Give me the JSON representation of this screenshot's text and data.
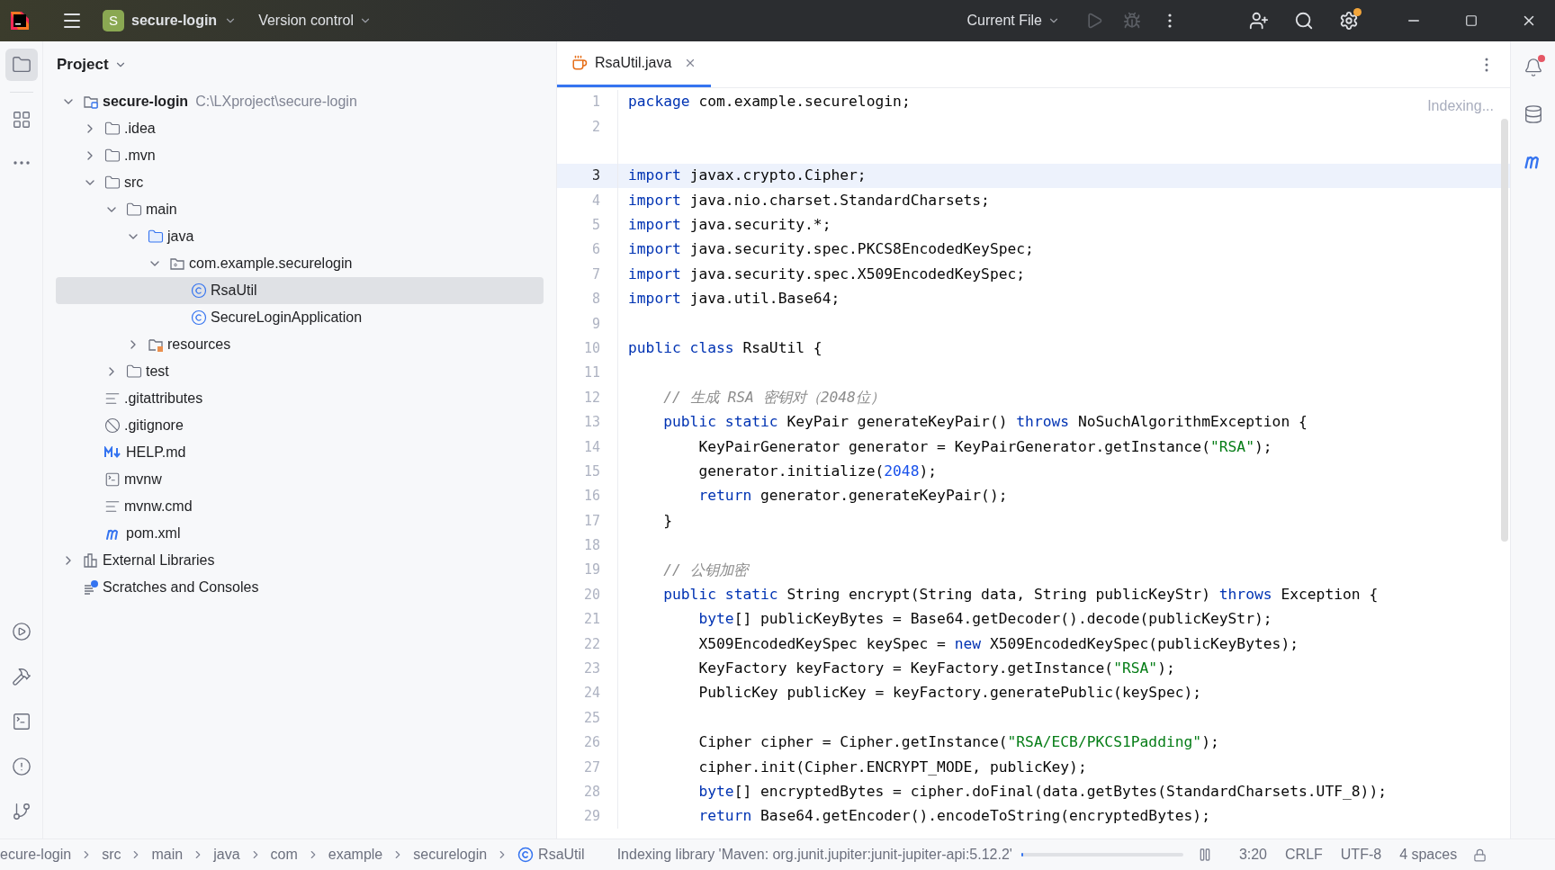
{
  "title_bar": {
    "project_badge": "S",
    "project": "secure-login",
    "vcs": "Version control",
    "run_config": "Current File",
    "run_disabled": true,
    "debug_disabled": true,
    "settings_notice": true
  },
  "left_toolbar": {
    "top": [
      {
        "kind": "project",
        "selected": true
      },
      {
        "kind": "structure",
        "selected": false
      },
      {
        "kind": "more",
        "selected": false
      }
    ],
    "bottom": [
      {
        "kind": "run",
        "selected": false
      },
      {
        "kind": "build",
        "selected": false
      },
      {
        "kind": "terminal",
        "selected": false
      },
      {
        "kind": "problems",
        "selected": false
      },
      {
        "kind": "git",
        "selected": false
      }
    ]
  },
  "project_panel": {
    "title": "Project",
    "tree": [
      {
        "kind": "module",
        "label": "secure-login",
        "path": "C:\\LXproject\\secure-login",
        "expanded": true,
        "selected": false,
        "children": [
          {
            "kind": "folder",
            "label": ".idea",
            "expanded": false,
            "selected": false
          },
          {
            "kind": "folder",
            "label": ".mvn",
            "expanded": false,
            "selected": false
          },
          {
            "kind": "folder",
            "label": "src",
            "expanded": true,
            "selected": false,
            "children": [
              {
                "kind": "folder",
                "label": "main",
                "expanded": true,
                "selected": false,
                "children": [
                  {
                    "kind": "source",
                    "label": "java",
                    "expanded": true,
                    "selected": false,
                    "children": [
                      {
                        "kind": "package",
                        "label": "com.example.securelogin",
                        "expanded": true,
                        "selected": false,
                        "children": [
                          {
                            "kind": "class",
                            "label": "RsaUtil",
                            "selected": true
                          },
                          {
                            "kind": "class",
                            "label": "SecureLoginApplication",
                            "selected": false
                          }
                        ]
                      }
                    ]
                  },
                  {
                    "kind": "resources",
                    "label": "resources",
                    "expanded": false,
                    "selected": false
                  }
                ]
              },
              {
                "kind": "folder",
                "label": "test",
                "expanded": false,
                "selected": false
              }
            ]
          },
          {
            "kind": "text",
            "label": ".gitattributes",
            "selected": false
          },
          {
            "kind": "ignore",
            "label": ".gitignore",
            "selected": false
          },
          {
            "kind": "markdown",
            "label": "HELP.md",
            "selected": false
          },
          {
            "kind": "script",
            "label": "mvnw",
            "selected": false
          },
          {
            "kind": "text",
            "label": "mvnw.cmd",
            "selected": false
          },
          {
            "kind": "maven",
            "label": "pom.xml",
            "selected": false
          }
        ]
      },
      {
        "kind": "library",
        "label": "External Libraries",
        "expanded": false,
        "selected": false
      },
      {
        "kind": "scratches",
        "label": "Scratches and Consoles",
        "selected": false
      }
    ]
  },
  "editor": {
    "tabs": [
      {
        "label": "RsaUtil.java",
        "selected": true
      }
    ],
    "status": "Indexing...",
    "lines": [
      {
        "number": "1",
        "current": false,
        "tokens": [
          {
            "kind": "keyword",
            "text": "package"
          },
          {
            "kind": "plain",
            "text": " com.example.securelogin;"
          }
        ]
      },
      {
        "number": "2",
        "current": false,
        "gap_after": true
      },
      {
        "number": "3",
        "current": true,
        "tokens": [
          {
            "kind": "keyword",
            "text": "import"
          },
          {
            "kind": "plain",
            "text": " javax.crypto.Cipher;"
          }
        ]
      },
      {
        "number": "4",
        "current": false,
        "tokens": [
          {
            "kind": "keyword",
            "text": "import"
          },
          {
            "kind": "plain",
            "text": " java.nio.charset.StandardCharsets;"
          }
        ]
      },
      {
        "number": "5",
        "current": false,
        "tokens": [
          {
            "kind": "keyword",
            "text": "import"
          },
          {
            "kind": "plain",
            "text": " java.security.*;"
          }
        ]
      },
      {
        "number": "6",
        "current": false,
        "tokens": [
          {
            "kind": "keyword",
            "text": "import"
          },
          {
            "kind": "plain",
            "text": " java.security.spec.PKCS8EncodedKeySpec;"
          }
        ]
      },
      {
        "number": "7",
        "current": false,
        "tokens": [
          {
            "kind": "keyword",
            "text": "import"
          },
          {
            "kind": "plain",
            "text": " java.security.spec.X509EncodedKeySpec;"
          }
        ]
      },
      {
        "number": "8",
        "current": false,
        "tokens": [
          {
            "kind": "keyword",
            "text": "import"
          },
          {
            "kind": "plain",
            "text": " java.util.Base64;"
          }
        ]
      },
      {
        "number": "9",
        "current": false
      },
      {
        "number": "10",
        "current": false,
        "tokens": [
          {
            "kind": "keyword",
            "text": "public class"
          },
          {
            "kind": "plain",
            "text": " RsaUtil {"
          }
        ]
      },
      {
        "number": "11",
        "current": false
      },
      {
        "number": "12",
        "current": false,
        "tokens": [
          {
            "kind": "comment",
            "text": "    // 生成 RSA 密钥对（2048位）"
          }
        ]
      },
      {
        "number": "13",
        "current": false,
        "tokens": [
          {
            "kind": "keyword",
            "text": "    public static"
          },
          {
            "kind": "plain",
            "text": " KeyPair generateKeyPair() "
          },
          {
            "kind": "keyword",
            "text": "throws"
          },
          {
            "kind": "plain",
            "text": " NoSuchAlgorithmException {"
          }
        ]
      },
      {
        "number": "14",
        "current": false,
        "tokens": [
          {
            "kind": "plain",
            "text": "        KeyPairGenerator generator = KeyPairGenerator.getInstance("
          },
          {
            "kind": "string",
            "text": "\"RSA\""
          },
          {
            "kind": "plain",
            "text": ");"
          }
        ]
      },
      {
        "number": "15",
        "current": false,
        "tokens": [
          {
            "kind": "plain",
            "text": "        generator.initialize("
          },
          {
            "kind": "number",
            "text": "2048"
          },
          {
            "kind": "plain",
            "text": ");"
          }
        ]
      },
      {
        "number": "16",
        "current": false,
        "tokens": [
          {
            "kind": "keyword",
            "text": "        return"
          },
          {
            "kind": "plain",
            "text": " generator.generateKeyPair();"
          }
        ]
      },
      {
        "number": "17",
        "current": false,
        "tokens": [
          {
            "kind": "plain",
            "text": "    }"
          }
        ]
      },
      {
        "number": "18",
        "current": false
      },
      {
        "number": "19",
        "current": false,
        "tokens": [
          {
            "kind": "comment",
            "text": "    // 公钥加密"
          }
        ]
      },
      {
        "number": "20",
        "current": false,
        "tokens": [
          {
            "kind": "keyword",
            "text": "    public static"
          },
          {
            "kind": "plain",
            "text": " String encrypt(String data, String publicKeyStr) "
          },
          {
            "kind": "keyword",
            "text": "throws"
          },
          {
            "kind": "plain",
            "text": " Exception {"
          }
        ]
      },
      {
        "number": "21",
        "current": false,
        "tokens": [
          {
            "kind": "keyword",
            "text": "        byte"
          },
          {
            "kind": "plain",
            "text": "[] publicKeyBytes = Base64.getDecoder().decode(publicKeyStr);"
          }
        ]
      },
      {
        "number": "22",
        "current": false,
        "tokens": [
          {
            "kind": "plain",
            "text": "        X509EncodedKeySpec keySpec = "
          },
          {
            "kind": "keyword",
            "text": "new"
          },
          {
            "kind": "plain",
            "text": " X509EncodedKeySpec(publicKeyBytes);"
          }
        ]
      },
      {
        "number": "23",
        "current": false,
        "tokens": [
          {
            "kind": "plain",
            "text": "        KeyFactory keyFactory = KeyFactory.getInstance("
          },
          {
            "kind": "string",
            "text": "\"RSA\""
          },
          {
            "kind": "plain",
            "text": ");"
          }
        ]
      },
      {
        "number": "24",
        "current": false,
        "tokens": [
          {
            "kind": "plain",
            "text": "        PublicKey publicKey = keyFactory.generatePublic(keySpec);"
          }
        ]
      },
      {
        "number": "25",
        "current": false
      },
      {
        "number": "26",
        "current": false,
        "tokens": [
          {
            "kind": "plain",
            "text": "        Cipher cipher = Cipher.getInstance("
          },
          {
            "kind": "string",
            "text": "\"RSA/ECB/PKCS1Padding\""
          },
          {
            "kind": "plain",
            "text": ");"
          }
        ]
      },
      {
        "number": "27",
        "current": false,
        "tokens": [
          {
            "kind": "plain",
            "text": "        cipher.init(Cipher.ENCRYPT_MODE, publicKey);"
          }
        ]
      },
      {
        "number": "28",
        "current": false,
        "tokens": [
          {
            "kind": "keyword",
            "text": "        byte"
          },
          {
            "kind": "plain",
            "text": "[] encryptedBytes = cipher.doFinal(data.getBytes(StandardCharsets.UTF_8));"
          }
        ]
      },
      {
        "number": "29",
        "current": false,
        "tokens": [
          {
            "kind": "keyword",
            "text": "        return"
          },
          {
            "kind": "plain",
            "text": " Base64.getEncoder().encodeToString(encryptedBytes);"
          }
        ]
      }
    ]
  },
  "right_toolbar": [
    {
      "kind": "notifications",
      "alert": true
    },
    {
      "kind": "database",
      "alert": false
    },
    {
      "kind": "maven",
      "alert": false
    }
  ],
  "status_bar": {
    "breadcrumbs": [
      {
        "kind": "folder",
        "label": "ecure-login"
      },
      {
        "kind": "folder",
        "label": "src"
      },
      {
        "kind": "folder",
        "label": "main"
      },
      {
        "kind": "folder",
        "label": "java"
      },
      {
        "kind": "folder",
        "label": "com"
      },
      {
        "kind": "folder",
        "label": "example"
      },
      {
        "kind": "folder",
        "label": "securelogin"
      },
      {
        "kind": "class",
        "label": "RsaUtil"
      }
    ],
    "message": "Indexing library 'Maven: org.junit.jupiter:junit-jupiter-api:5.12.2'",
    "progress": {
      "level": 0.01
    },
    "position": "3:20",
    "line_ending": "CRLF",
    "encoding": "UTF-8",
    "indent": "4 spaces",
    "read_only": true
  }
}
